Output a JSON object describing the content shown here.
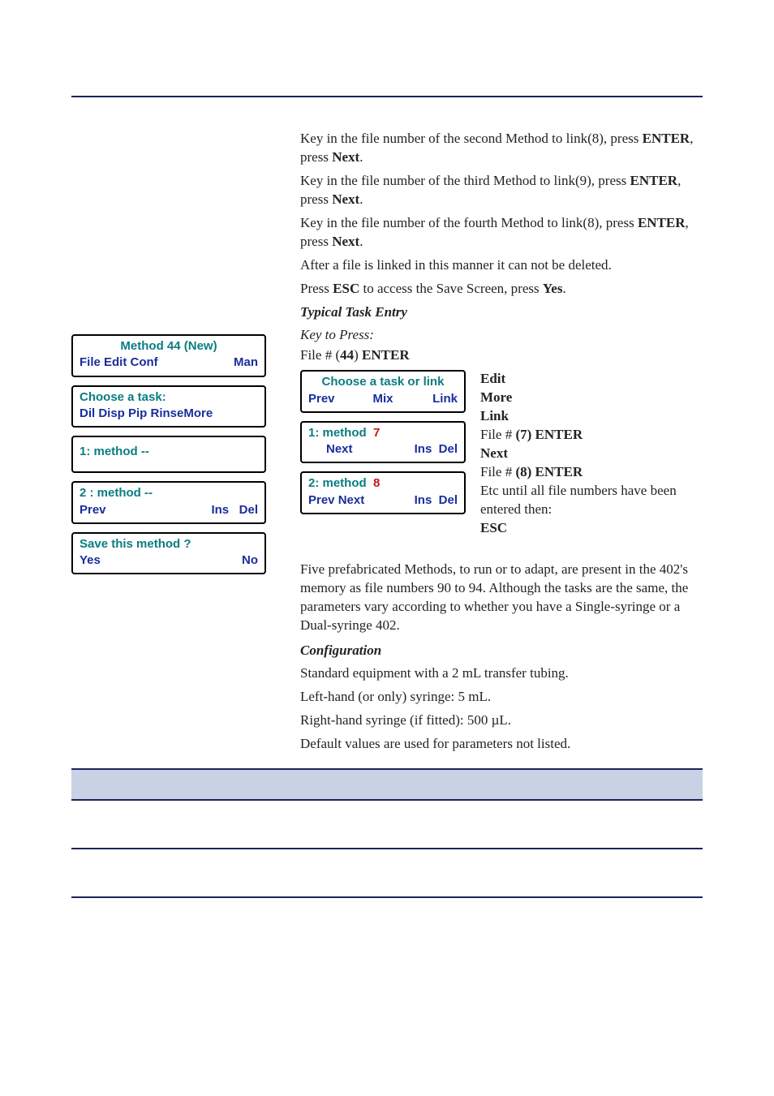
{
  "header_rule": true,
  "intro": {
    "p1a": "Key in the file number of the second Method to link(8), press ",
    "p1b": "ENTER",
    "p1c": ", press ",
    "p1d": "Next",
    "p1e": ".",
    "p2a": "Key in the file number of the third Method to link(9), press ",
    "p2b": "ENTER",
    "p2c": ", press ",
    "p2d": "Next",
    "p2e": ".",
    "p3a": "Key in the file number of the fourth Method to link(8), press ",
    "p3b": "ENTER",
    "p3c": ", press ",
    "p3d": "Next",
    "p3e": ".",
    "p4": "After a file is linked in this manner it can not be deleted.",
    "p5a": "Press ",
    "p5b": "ESC",
    "p5c": " to access the Save Screen, press ",
    "p5d": "Yes",
    "p5e": "."
  },
  "typical": {
    "heading": "Typical Task Entry",
    "key_to_press": "Key to Press:",
    "file_line_a": "File # (",
    "file_line_b": "44",
    "file_line_c": ") ",
    "file_line_d": "ENTER"
  },
  "lcd_left": {
    "box1_line1": "Method 44 (New)",
    "box1_menu_left": "File Edit Conf",
    "box1_menu_right": "Man",
    "box2_line1": "Choose a task:",
    "box2_line2": "Dil Disp Pip RinseMore",
    "box3": "1: method  --",
    "box4_line1": "2 : method  --",
    "box4_prev": "Prev",
    "box4_ins": "Ins",
    "box4_del": "Del",
    "box5_line1": "Save this method ?",
    "box5_yes": "Yes",
    "box5_no": "No"
  },
  "lcd_mid": {
    "box1_title": "Choose a task or link",
    "box1_prev": "Prev",
    "box1_mix": "Mix",
    "box1_link": "Link",
    "box2_label": "1: method",
    "box2_val": "7",
    "box2_next": "Next",
    "box2_ins": "Ins",
    "box2_del": "Del",
    "box3_label": "2: method",
    "box3_val": "8",
    "box3_prev": "Prev",
    "box3_next": "Next",
    "box3_ins": "Ins",
    "box3_del": "Del"
  },
  "keys": {
    "edit": "Edit",
    "more": "More",
    "link": "Link",
    "f7a": "File # ",
    "f7b": "(7) ENTER",
    "next": "Next",
    "f8a": "File # ",
    "f8b": "(8) ENTER",
    "etc": "Etc until all file numbers have been entered then:",
    "esc": "ESC"
  },
  "prefab": {
    "p1": "Five prefabricated Methods, to run or to adapt, are present in the 402's memory as file numbers 90 to 94. Although the tasks are the same, the parameters vary according to whether you have a Single-syringe or a Dual-syringe 402.",
    "cfg_heading": "Configuration",
    "c1": "Standard equipment with a 2 mL transfer tubing.",
    "c2": "Left-hand (or only) syringe: 5 mL.",
    "c3": "Right-hand syringe (if fitted): 500 µL.",
    "c4": "Default values are used for parameters not listed."
  }
}
